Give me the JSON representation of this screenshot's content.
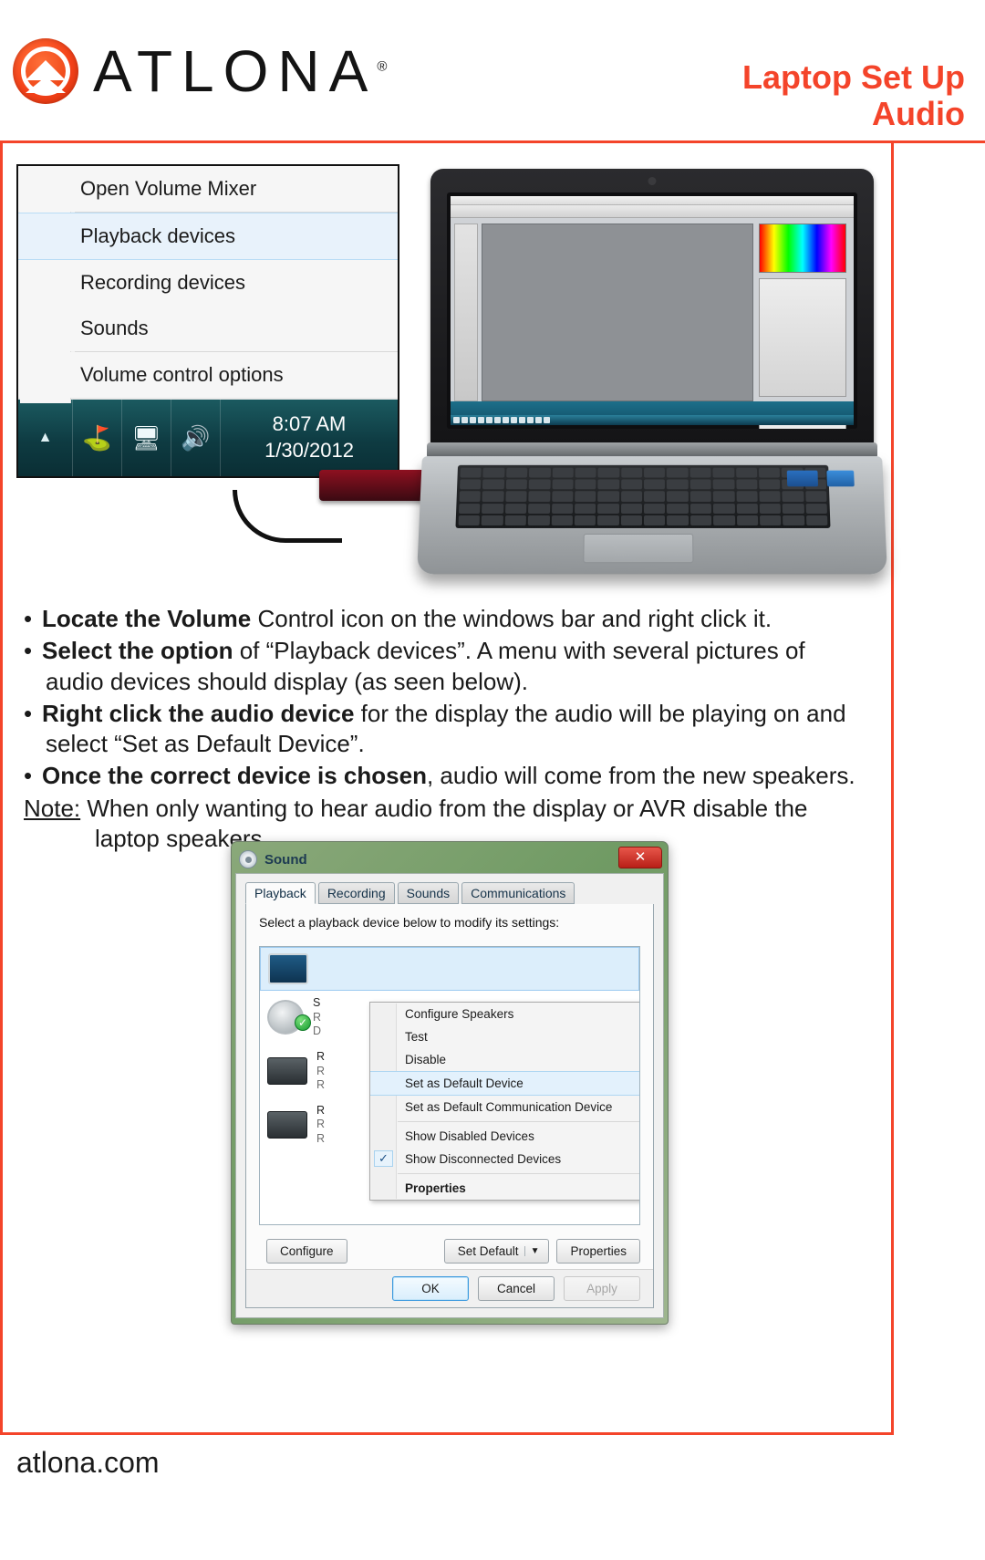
{
  "header": {
    "brand": "ATLONA",
    "brand_reg": "®",
    "title_main": "Laptop Set Up",
    "title_sub": "Audio",
    "accent_color": "#f4442a"
  },
  "volume_menu": {
    "items": [
      {
        "label": "Open Volume Mixer",
        "selected": false
      },
      {
        "label": "Playback devices",
        "selected": true
      },
      {
        "label": "Recording devices",
        "selected": false
      },
      {
        "label": "Sounds",
        "selected": false
      },
      {
        "label": "Volume control options",
        "selected": false
      }
    ],
    "tray": {
      "arrow_icon": "show-hidden-icons-arrow",
      "flag_icon": "action-center-flag-icon",
      "network_icon": "network-icon",
      "volume_icon": "volume-speaker-icon",
      "time": "8:07 AM",
      "date": "1/30/2012"
    }
  },
  "laptop_photo": {
    "alt": "laptop with HDMI dongle connected showing an image editor on screen"
  },
  "instructions": {
    "bullets": [
      {
        "bold": "Locate the Volume",
        "rest": " Control icon on the windows bar and right click it."
      },
      {
        "bold": "Select the option",
        "rest": " of “Playback devices”. A menu with several pictures of",
        "cont": "audio devices should display (as seen below)."
      },
      {
        "bold": "Right click the audio device",
        "rest": " for the display the audio will be playing on and",
        "cont": "select “Set as Default Device”."
      },
      {
        "bold": "Once the correct device is chosen",
        "rest": ", audio will come from the new speakers."
      }
    ],
    "note_label": "Note:",
    "note_text": " When only wanting to hear audio from the display or AVR disable the",
    "note_cont": "laptop speakers."
  },
  "sound_dialog": {
    "title": "Sound",
    "gear_icon": "sound-gear-icon",
    "close_label": "✕",
    "tabs": [
      {
        "label": "Playback",
        "active": true
      },
      {
        "label": "Recording",
        "active": false
      },
      {
        "label": "Sounds",
        "active": false
      },
      {
        "label": "Communications",
        "active": false
      }
    ],
    "hint": "Select a playback device below to modify its settings:",
    "devices": [
      {
        "icon": "monitor-icon",
        "lines": [
          "",
          "",
          ""
        ],
        "selected": true,
        "default_badge": false
      },
      {
        "icon": "speaker-icon",
        "lines": [
          "S",
          "R",
          "D"
        ],
        "selected": false,
        "default_badge": true
      },
      {
        "icon": "digital-output-icon",
        "lines": [
          "R",
          "R",
          "R"
        ],
        "selected": false,
        "default_badge": false
      },
      {
        "icon": "digital-output-icon",
        "lines": [
          "R",
          "R",
          "R"
        ],
        "selected": false,
        "default_badge": false
      }
    ],
    "context_menu": [
      {
        "label": "Configure Speakers",
        "selected": false,
        "bold": false,
        "checked": false
      },
      {
        "label": "Test",
        "selected": false,
        "bold": false,
        "checked": false
      },
      {
        "label": "Disable",
        "selected": false,
        "bold": false,
        "checked": false
      },
      {
        "label": "Set as Default Device",
        "selected": true,
        "bold": false,
        "checked": false
      },
      {
        "label": "Set as Default Communication Device",
        "selected": false,
        "bold": false,
        "checked": false
      },
      {
        "label": "Show Disabled Devices",
        "selected": false,
        "bold": false,
        "checked": false
      },
      {
        "label": "Show Disconnected Devices",
        "selected": false,
        "bold": false,
        "checked": true
      },
      {
        "label": "Properties",
        "selected": false,
        "bold": true,
        "checked": false
      }
    ],
    "buttons": {
      "configure": "Configure",
      "set_default": "Set Default",
      "set_default_caret": "▼",
      "properties": "Properties",
      "ok": "OK",
      "cancel": "Cancel",
      "apply": "Apply"
    }
  },
  "footer": {
    "url": "atlona.com"
  }
}
